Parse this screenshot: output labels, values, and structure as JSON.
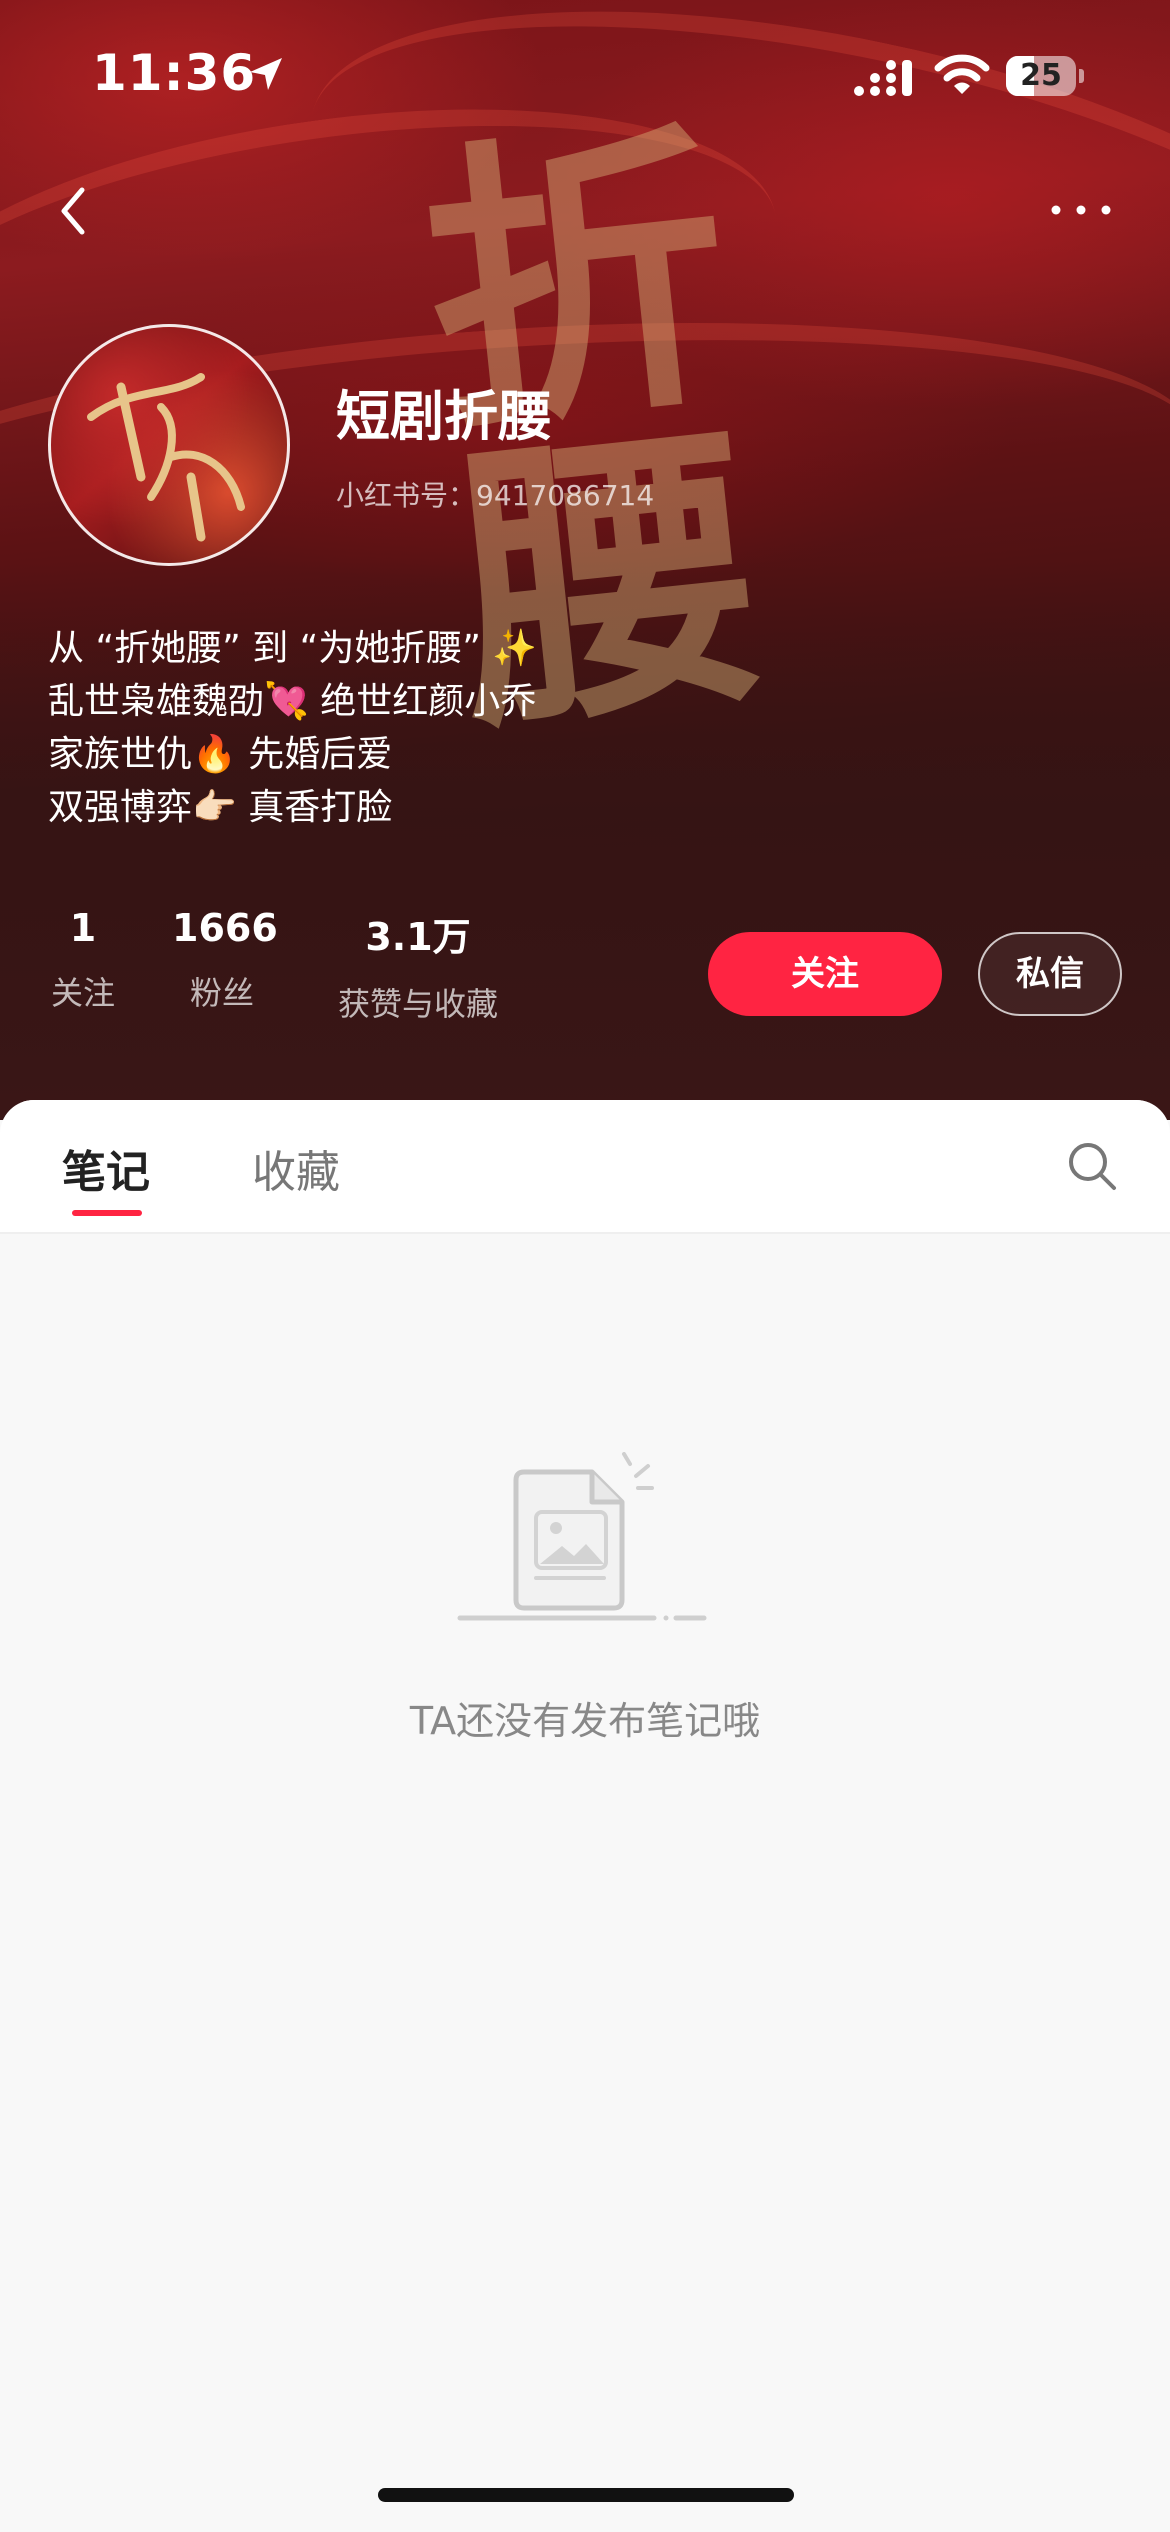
{
  "status_bar": {
    "time": "11:36",
    "battery": "25"
  },
  "cover_text": "折腰",
  "profile": {
    "nickname": "短剧折腰",
    "red_id": "小红书号：9417086714",
    "bio": [
      "从 “折她腰” 到 “为她折腰” ✨",
      "乱世枭雄魏劭💘 绝世红颜小乔",
      "家族世仇🔥 先婚后爱",
      "双强博弈👉🏻 真香打脸"
    ]
  },
  "stats": {
    "following": {
      "value": "1",
      "label": "关注"
    },
    "followers": {
      "value": "1666",
      "label": "粉丝"
    },
    "likes": {
      "value": "3.1万",
      "label": "获赞与收藏"
    }
  },
  "actions": {
    "follow": "关注",
    "message": "私信"
  },
  "tabs": {
    "notes": "笔记",
    "collections": "收藏"
  },
  "empty_state": {
    "text": "TA还没有发布笔记哦"
  },
  "colors": {
    "accent": "#ff2442",
    "header_dark": "#3a1616"
  }
}
